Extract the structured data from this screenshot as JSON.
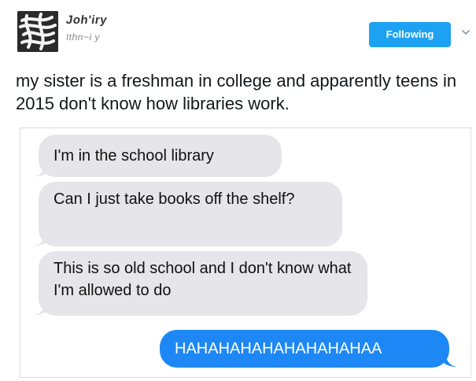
{
  "user": {
    "display_name": "Joh'iry",
    "handle": "Ithn~i y"
  },
  "follow_button": {
    "label": "Following"
  },
  "tweet": {
    "text": "my sister is a freshman in college and apparently teens in 2015 don't know how libraries work."
  },
  "messages": [
    {
      "direction": "incoming",
      "text": "I'm in the school library"
    },
    {
      "direction": "incoming",
      "text": "Can I just take books off the shelf?"
    },
    {
      "direction": "incoming",
      "text": "This is so old school and I don't know what I'm allowed to do"
    },
    {
      "direction": "outgoing",
      "text": "HAHAHAHAHAHAHAHAHAA"
    }
  ],
  "colors": {
    "follow_button": "#1da1f2",
    "incoming_bubble": "#e5e5ea",
    "outgoing_bubble": "#1d88f5"
  },
  "icons": {
    "caret": "chevron-down-icon"
  }
}
